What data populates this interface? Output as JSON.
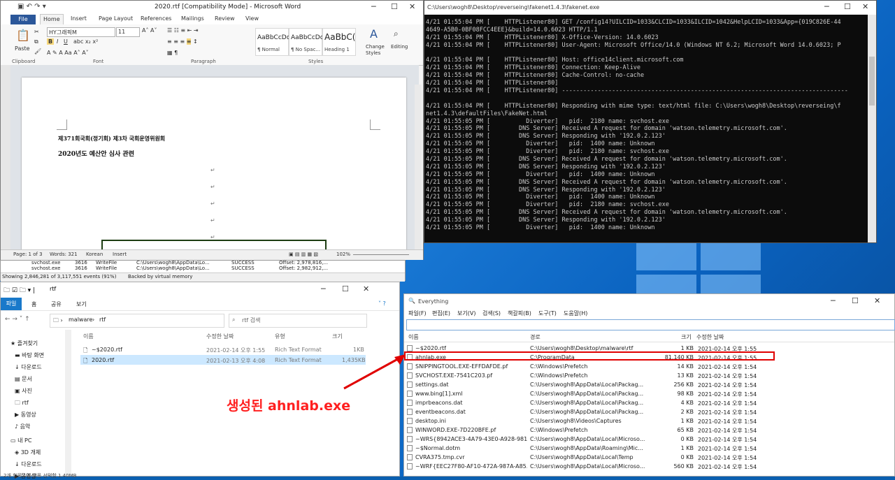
{
  "word": {
    "title": "2020.rtf [Compatibility Mode] - Microsoft Word",
    "tabs": [
      "File",
      "Home",
      "Insert",
      "Page Layout",
      "References",
      "Mailings",
      "Review",
      "View"
    ],
    "font_name": "HY그래픽M",
    "font_size": "11",
    "groups": {
      "clipboard": "Clipboard",
      "font": "Font",
      "paragraph": "Paragraph",
      "styles": "Styles"
    },
    "paste_label": "Paste",
    "styles": [
      {
        "sample": "AaBbCcDc",
        "name": "¶ Normal"
      },
      {
        "sample": "AaBbCcDc",
        "name": "¶ No Spac..."
      },
      {
        "sample": "AaBbC(",
        "name": "Heading 1"
      }
    ],
    "change_styles": "Change Styles",
    "editing": "Editing",
    "doc_line1": "제371회국회(정기회) 제3차 국회운영위원회",
    "doc_line2": "2020년도 예산안 심사 관련",
    "status": {
      "page": "Page: 1 of 3",
      "words": "Words: 321",
      "lang": "Korean",
      "mode": "Insert",
      "zoom": "102%"
    }
  },
  "procmon": {
    "rows": [
      {
        "proc": "svchost.exe",
        "pid": "3616",
        "op": "WriteFile",
        "path": "C:\\Users\\wogh8\\AppData\\Lo...",
        "result": "SUCCESS",
        "detail": "Offset: 2,978,816,..."
      },
      {
        "proc": "svchost.exe",
        "pid": "3616",
        "op": "WriteFile",
        "path": "C:\\Users\\wogh8\\AppData\\Lo...",
        "result": "SUCCESS",
        "detail": "Offset: 2,982,912,..."
      }
    ],
    "status_events": "Showing 2,846,281 of 3,117,551 events (91%)",
    "status_backing": "Backed by virtual memory"
  },
  "console": {
    "title": "C:\\Users\\wogh8\\Desktop\\reverseing\\fakenet1.4.3\\fakenet.exe",
    "lines": [
      "4/21 01:55:04 PM [    HTTPListener80] GET /config14?UILCID=1033&CLCID=1033&ILCID=1042&HelpLCID=1033&App={019C826E-44",
      "4649-A5B0-0BF08FCC4EEE}&build=14.0.6023 HTTP/1.1",
      "4/21 01:55:04 PM [    HTTPListener80] X-Office-Version: 14.0.6023",
      "4/21 01:55:04 PM [    HTTPListener80] User-Agent: Microsoft Office/14.0 (Windows NT 6.2; Microsoft Word 14.0.6023; P",
      "",
      "4/21 01:55:04 PM [    HTTPListener80] Host: office14client.microsoft.com",
      "4/21 01:55:04 PM [    HTTPListener80] Connection: Keep-Alive",
      "4/21 01:55:04 PM [    HTTPListener80] Cache-Control: no-cache",
      "4/21 01:55:04 PM [    HTTPListener80]",
      "4/21 01:55:04 PM [    HTTPListener80] --------------------------------------------------------------------------------",
      "",
      "4/21 01:55:04 PM [    HTTPListener80] Responding with mime type: text/html file: C:\\Users\\wogh8\\Desktop\\reverseing\\f",
      "net1.4.3\\defaultFiles\\FakeNet.html",
      "4/21 01:55:05 PM [          Diverter]   pid:  2180 name: svchost.exe",
      "4/21 01:55:05 PM [        DNS Server] Received A request for domain 'watson.telemetry.microsoft.com'.",
      "4/21 01:55:05 PM [        DNS Server] Responding with '192.0.2.123'",
      "4/21 01:55:05 PM [          Diverter]   pid:  1400 name: Unknown",
      "4/21 01:55:05 PM [          Diverter]   pid:  2180 name: svchost.exe",
      "4/21 01:55:05 PM [        DNS Server] Received A request for domain 'watson.telemetry.microsoft.com'.",
      "4/21 01:55:05 PM [        DNS Server] Responding with '192.0.2.123'",
      "4/21 01:55:05 PM [          Diverter]   pid:  1400 name: Unknown",
      "4/21 01:55:05 PM [        DNS Server] Received A request for domain 'watson.telemetry.microsoft.com'.",
      "4/21 01:55:05 PM [        DNS Server] Responding with '192.0.2.123'",
      "4/21 01:55:05 PM [          Diverter]   pid:  1400 name: Unknown",
      "4/21 01:55:05 PM [          Diverter]   pid:  2180 name: svchost.exe",
      "4/21 01:55:05 PM [        DNS Server] Received A request for domain 'watson.telemetry.microsoft.com'.",
      "4/21 01:55:05 PM [        DNS Server] Responding with '192.0.2.123'",
      "4/21 01:55:05 PM [          Diverter]   pid:  1400 name: Unknown"
    ]
  },
  "explorer": {
    "title": "rtf",
    "menu": [
      "파일",
      "홈",
      "공유",
      "보기"
    ],
    "path": [
      "malware",
      "rtf"
    ],
    "search_placeholder": "rtf 검색",
    "nav": [
      "즐겨찾기",
      "바탕 화면",
      "다운로드",
      "문서",
      "사진",
      "rtf",
      "동영상",
      "음악",
      "내 PC",
      "3D 개체",
      "다운로드",
      "동영상"
    ],
    "columns": [
      "이름",
      "수정한 날짜",
      "유형",
      "크기"
    ],
    "files": [
      {
        "name": "~$2020.rtf",
        "date": "2021-02-14 오후 1:55",
        "type": "Rich Text Format",
        "size": "1KB"
      },
      {
        "name": "2020.rtf",
        "date": "2021-02-13 오후 4:08",
        "type": "Rich Text Format",
        "size": "1,435KB"
      }
    ],
    "status": "2개 항목   1개 항목 선택함 1.40MB"
  },
  "everything": {
    "title": "Everything",
    "menu": [
      "파일(F)",
      "편집(E)",
      "보기(V)",
      "검색(S)",
      "책갈피(B)",
      "도구(T)",
      "도움말(H)"
    ],
    "columns": [
      "이름",
      "경로",
      "크기",
      "수정한 날짜"
    ],
    "rows": [
      {
        "name": "~$2020.rtf",
        "path": "C:\\Users\\wogh8\\Desktop\\malware\\rtf",
        "size": "1 KB",
        "date": "2021-02-14 오후 1:55"
      },
      {
        "name": "ahnlab.exe",
        "path": "C:\\ProgramData",
        "size": "81,140 KB",
        "date": "2021-02-14 오후 1:55"
      },
      {
        "name": "SNIPPINGTOOL.EXE-EFFDAFDE.pf",
        "path": "C:\\Windows\\Prefetch",
        "size": "14 KB",
        "date": "2021-02-14 오후 1:54"
      },
      {
        "name": "SVCHOST.EXE-7541C203.pf",
        "path": "C:\\Windows\\Prefetch",
        "size": "13 KB",
        "date": "2021-02-14 오후 1:54"
      },
      {
        "name": "settings.dat",
        "path": "C:\\Users\\wogh8\\AppData\\Local\\Packag...",
        "size": "256 KB",
        "date": "2021-02-14 오후 1:54"
      },
      {
        "name": "www.bing[1].xml",
        "path": "C:\\Users\\wogh8\\AppData\\Local\\Packag...",
        "size": "98 KB",
        "date": "2021-02-14 오후 1:54"
      },
      {
        "name": "imprbeacons.dat",
        "path": "C:\\Users\\wogh8\\AppData\\Local\\Packag...",
        "size": "4 KB",
        "date": "2021-02-14 오후 1:54"
      },
      {
        "name": "eventbeacons.dat",
        "path": "C:\\Users\\wogh8\\AppData\\Local\\Packag...",
        "size": "2 KB",
        "date": "2021-02-14 오후 1:54"
      },
      {
        "name": "desktop.ini",
        "path": "C:\\Users\\wogh8\\Videos\\Captures",
        "size": "1 KB",
        "date": "2021-02-14 오후 1:54"
      },
      {
        "name": "WINWORD.EXE-7D220BFE.pf",
        "path": "C:\\Windows\\Prefetch",
        "size": "65 KB",
        "date": "2021-02-14 오후 1:54"
      },
      {
        "name": "~WRS{8942ACE3-4A79-43E0-A928-981...",
        "path": "C:\\Users\\wogh8\\AppData\\Local\\Microso...",
        "size": "0 KB",
        "date": "2021-02-14 오후 1:54"
      },
      {
        "name": "~$Normal.dotm",
        "path": "C:\\Users\\wogh8\\AppData\\Roaming\\Mic...",
        "size": "1 KB",
        "date": "2021-02-14 오후 1:54"
      },
      {
        "name": "CVRA375.tmp.cvr",
        "path": "C:\\Users\\wogh8\\AppData\\Local\\Temp",
        "size": "0 KB",
        "date": "2021-02-14 오후 1:54"
      },
      {
        "name": "~WRF{EEC27F80-AF10-472A-987A-A85...",
        "path": "C:\\Users\\wogh8\\AppData\\Local\\Microso...",
        "size": "560 KB",
        "date": "2021-02-14 오후 1:54"
      }
    ]
  },
  "annotation": "생성된 ahnlab.exe",
  "colors": {
    "highlight": "#e00000",
    "annotation": "#ff1f1f",
    "word_blue": "#2b579a",
    "explorer_blue": "#1979ca"
  }
}
